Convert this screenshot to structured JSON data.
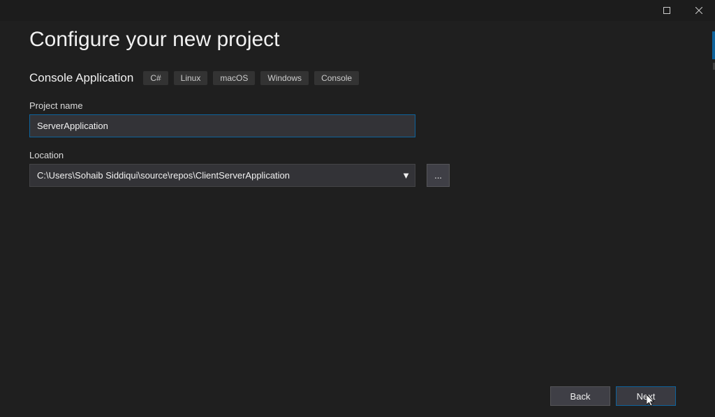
{
  "titlebar": {
    "maximize_icon": "maximize",
    "close_icon": "close"
  },
  "page": {
    "title": "Configure your new project",
    "template_name": "Console Application",
    "tags": [
      "C#",
      "Linux",
      "macOS",
      "Windows",
      "Console"
    ]
  },
  "fields": {
    "project_name_label": "Project name",
    "project_name_value": "ServerApplication",
    "location_label": "Location",
    "location_value": "C:\\Users\\Sohaib Siddiqui\\source\\repos\\ClientServerApplication",
    "browse_label": "..."
  },
  "footer": {
    "back_label": "Back",
    "next_label": "Next"
  }
}
